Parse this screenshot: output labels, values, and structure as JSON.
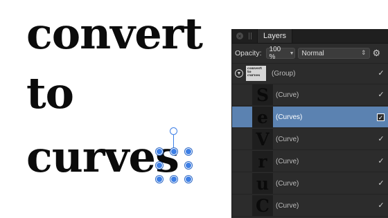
{
  "canvas": {
    "lines": [
      "convert",
      "to",
      "curves"
    ]
  },
  "layers_panel": {
    "tab_label": "Layers",
    "opacity_label": "Opacity:",
    "opacity_value": "100 %",
    "blend_mode": "Normal",
    "layers": [
      {
        "name": "(Group)",
        "thumb": "convert to curves",
        "selected": false,
        "checked": true
      },
      {
        "name": "(Curve)",
        "thumb": "S",
        "selected": false,
        "checked": true
      },
      {
        "name": "(Curves)",
        "thumb": "e",
        "selected": true,
        "checked": true
      },
      {
        "name": "(Curve)",
        "thumb": "V",
        "selected": false,
        "checked": true
      },
      {
        "name": "(Curve)",
        "thumb": "r",
        "selected": false,
        "checked": true
      },
      {
        "name": "(Curve)",
        "thumb": "u",
        "selected": false,
        "checked": true
      },
      {
        "name": "(Curve)",
        "thumb": "C",
        "selected": false,
        "checked": true
      }
    ]
  },
  "colors": {
    "selection_blue": "#3d7fe6",
    "selected_row": "#5b82b1",
    "panel_bg": "#2c2c2c"
  }
}
